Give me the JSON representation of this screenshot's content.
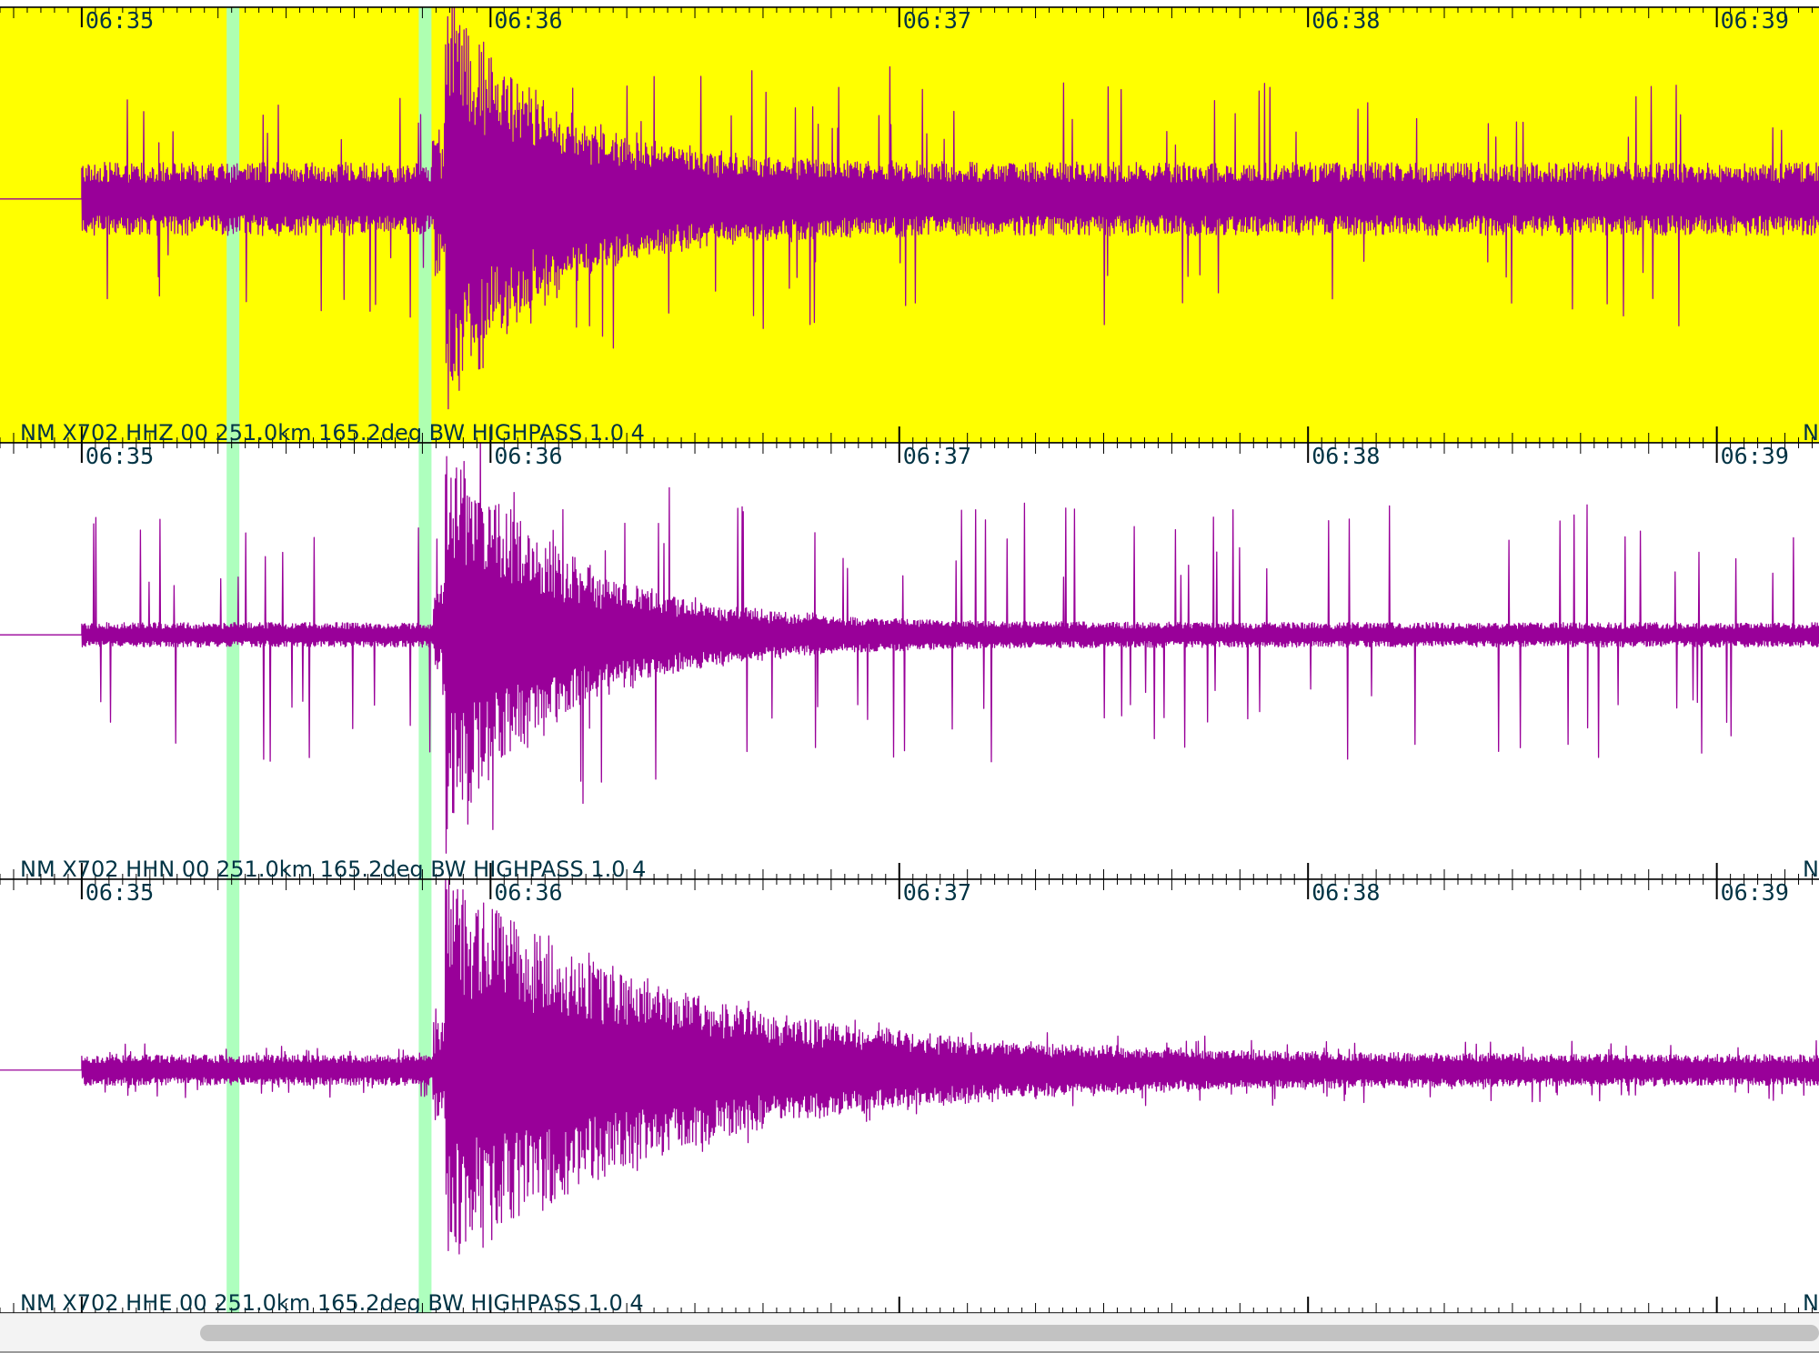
{
  "chart_data": {
    "type": "line",
    "colors": {
      "waveform": "#990099",
      "selected_background": "#ffff00",
      "background": "#ffffff",
      "pick_marker": "#aaffbb",
      "text": "#003344"
    },
    "time_axis": {
      "tick_labels": [
        "06:35",
        "06:36",
        "06:37",
        "06:38",
        "06:39"
      ],
      "xlim": [
        -0.2,
        4.25
      ],
      "units": "minutes after 06:35"
    },
    "pick_markers": [
      0.37,
      0.84
    ],
    "event_onset": 0.89,
    "traces": [
      {
        "label": "NM X702 HHZ 00 251.0km 165.2deg BW HIGHPASS 1.0 4",
        "selected": true,
        "noise_amplitude": 0.12,
        "event_amplitude": 0.9,
        "spike_amplitude": 0.45,
        "decay_minutes": 0.25,
        "ylim": [
          -1,
          1
        ]
      },
      {
        "label": "NM X702 HHN 00 251.0km 165.2deg BW HIGHPASS 1.0 4",
        "selected": false,
        "noise_amplitude": 0.04,
        "event_amplitude": 0.9,
        "spike_amplitude": 0.55,
        "decay_minutes": 0.3,
        "ylim": [
          -1,
          1
        ]
      },
      {
        "label": "NM X702 HHE 00 251.0km 165.2deg BW HIGHPASS 1.0 4",
        "selected": false,
        "noise_amplitude": 0.05,
        "event_amplitude": 0.9,
        "spike_amplitude": 0.08,
        "decay_minutes": 0.55,
        "ylim": [
          -1,
          1
        ]
      }
    ],
    "clipped_label_text": "N"
  }
}
